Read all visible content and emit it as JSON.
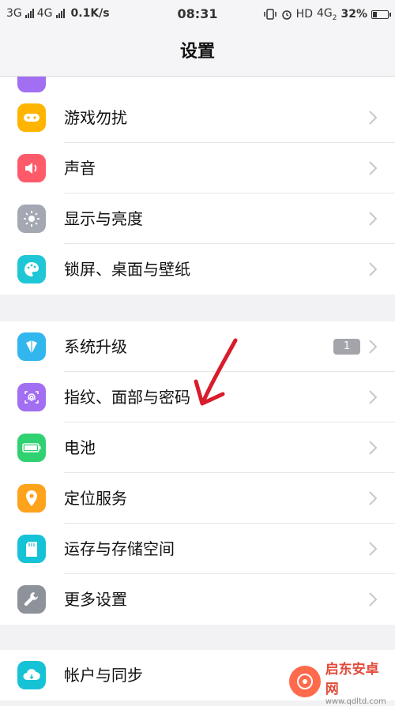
{
  "status_bar": {
    "network1": "3G",
    "network2": "4G",
    "speed": "0.1K/s",
    "time": "08:31",
    "hd": "HD",
    "network3": "4G",
    "network3_sub": "2",
    "battery": "32%",
    "battery_level": 0.32
  },
  "header": {
    "title": "设置"
  },
  "groups": [
    {
      "items": [
        {
          "label": "游戏勿扰",
          "icon": "gamepad-icon",
          "color": "#ffb400"
        },
        {
          "label": "声音",
          "icon": "speaker-icon",
          "color": "#ff5a69"
        },
        {
          "label": "显示与亮度",
          "icon": "brightness-icon",
          "color": "#a3a8b3"
        },
        {
          "label": "锁屏、桌面与壁纸",
          "icon": "palette-icon",
          "color": "#1fc7d6"
        }
      ]
    },
    {
      "items": [
        {
          "label": "系统升级",
          "icon": "upgrade-icon",
          "color": "#32b6ee",
          "badge": "1"
        },
        {
          "label": "指纹、面部与密码",
          "icon": "fingerprint-icon",
          "color": "#a26ef2"
        },
        {
          "label": "电池",
          "icon": "battery-icon",
          "color": "#2fd171"
        },
        {
          "label": "定位服务",
          "icon": "location-icon",
          "color": "#ffa21c"
        },
        {
          "label": "运存与存储空间",
          "icon": "sdcard-icon",
          "color": "#16c2d6"
        },
        {
          "label": "更多设置",
          "icon": "wrench-icon",
          "color": "#8e929b"
        }
      ]
    },
    {
      "items": [
        {
          "label": "帐户与同步",
          "icon": "cloud-sync-icon",
          "color": "#16c2d6"
        }
      ]
    }
  ],
  "watermark": {
    "brand": "启东安卓网",
    "url": "www.qdltd.com"
  }
}
